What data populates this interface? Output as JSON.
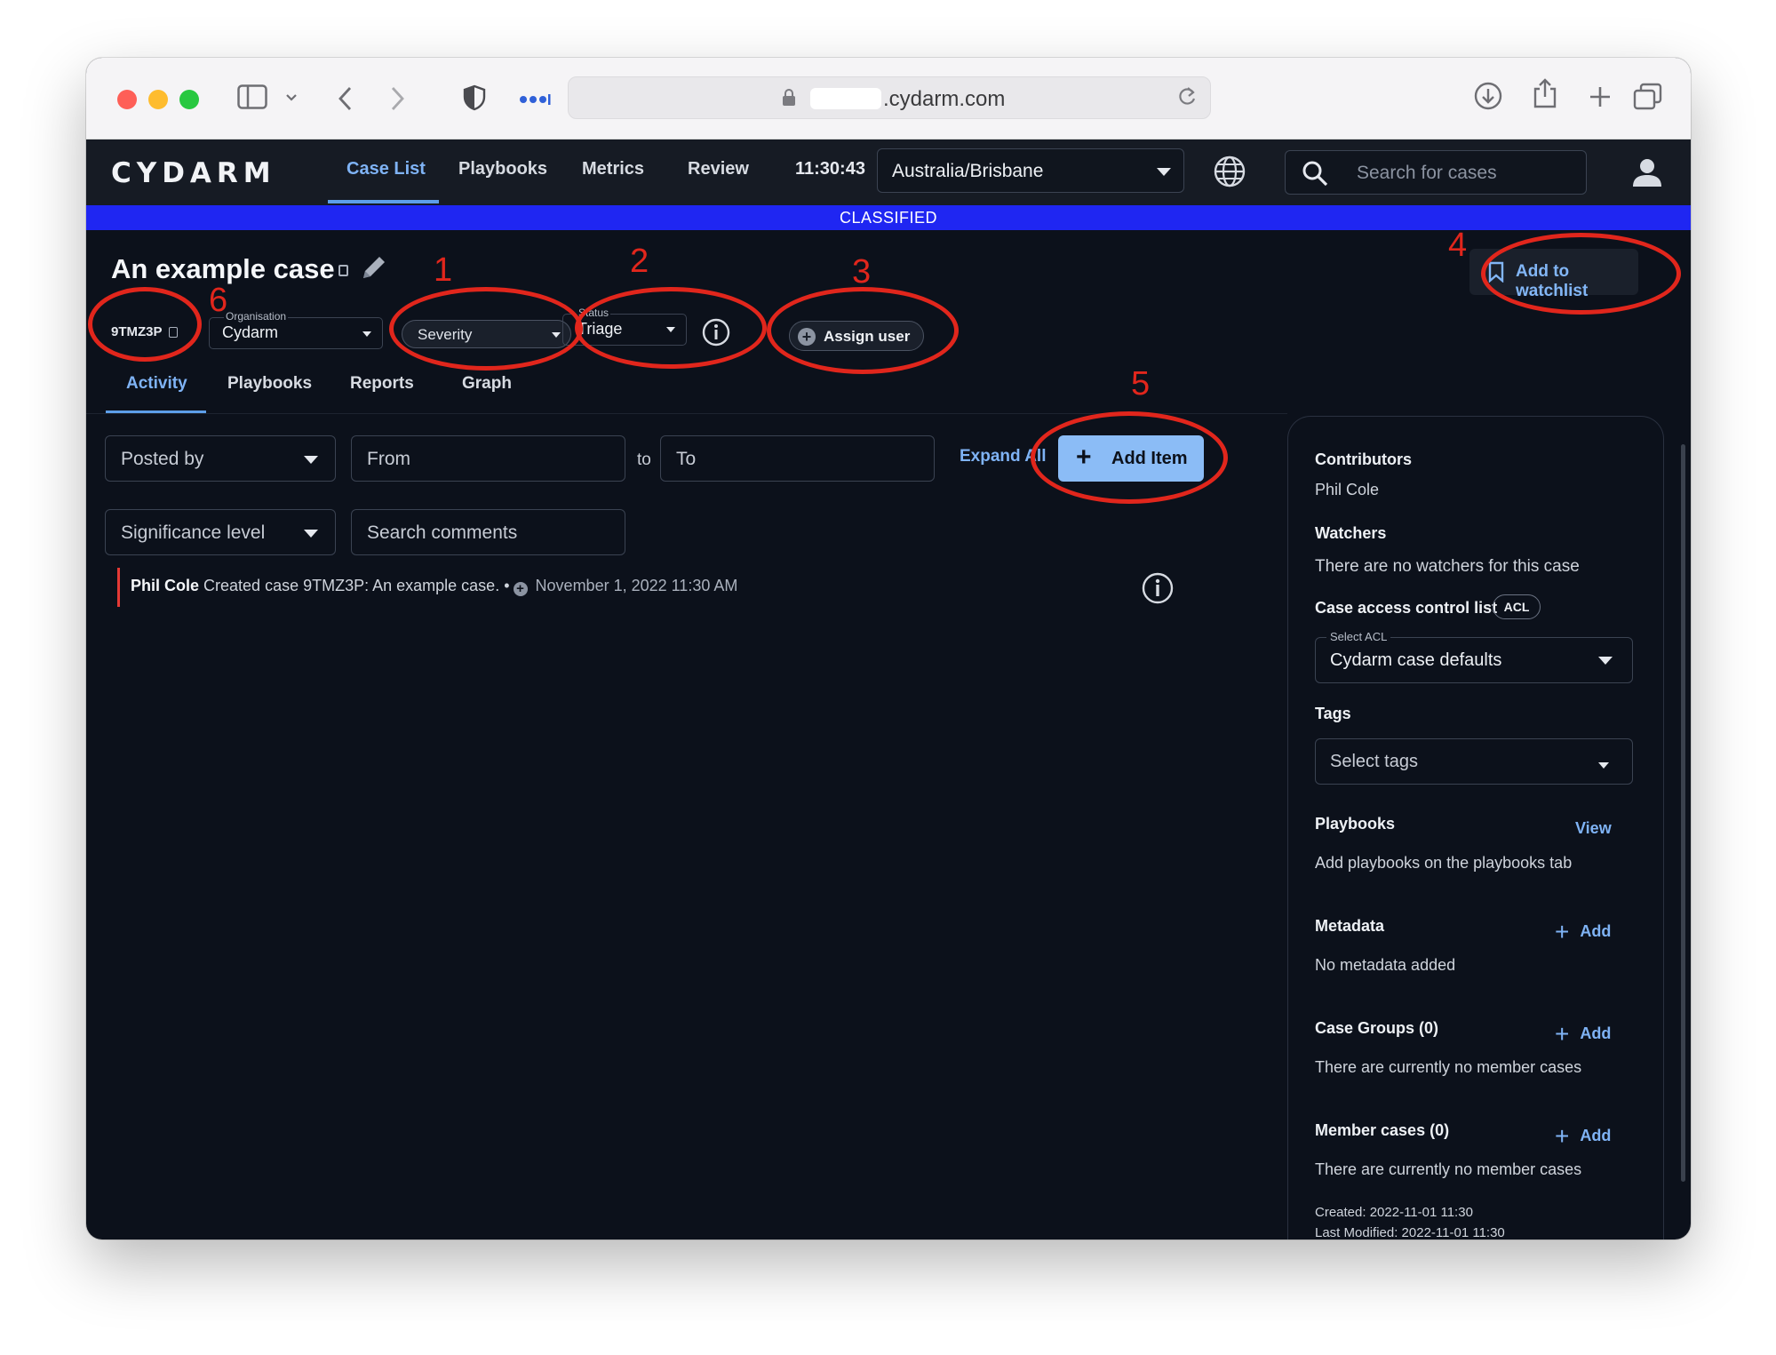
{
  "browser": {
    "url_domain": ".cydarm.com"
  },
  "app": {
    "logo": "CYDARM",
    "nav": [
      {
        "label": "Case List"
      },
      {
        "label": "Playbooks"
      },
      {
        "label": "Metrics"
      },
      {
        "label": "Review"
      }
    ],
    "clock": "11:30:43",
    "timezone": "Australia/Brisbane",
    "search_placeholder": "Search for cases",
    "classification": "CLASSIFIED"
  },
  "case": {
    "title": "An example case",
    "id": "9TMZ3P",
    "organisation_label": "Organisation",
    "organisation_value": "Cydarm",
    "severity_placeholder": "Severity",
    "status_label": "Status",
    "status_value": "Triage",
    "assign_label": "Assign user",
    "watchlist_label": "Add to watchlist"
  },
  "tabs": [
    {
      "label": "Activity"
    },
    {
      "label": "Playbooks"
    },
    {
      "label": "Reports"
    },
    {
      "label": "Graph"
    }
  ],
  "filters": {
    "posted_by": "Posted by",
    "from_placeholder": "From",
    "to_word": "to",
    "to_placeholder": "To",
    "significance": "Significance level",
    "search_comments_placeholder": "Search comments",
    "expand_all": "Expand All",
    "add_item": "Add Item"
  },
  "activity": [
    {
      "author": "Phil Cole",
      "text": "Created case 9TMZ3P: An example case.",
      "separator": "•",
      "date": "November 1, 2022 11:30 AM"
    }
  ],
  "sidebar": {
    "contributors_title": "Contributors",
    "contributors_value": "Phil Cole",
    "watchers_title": "Watchers",
    "watchers_value": "There are no watchers for this case",
    "acl_title": "Case access control list",
    "acl_badge": "ACL",
    "acl_select_label": "Select ACL",
    "acl_select_value": "Cydarm case defaults",
    "tags_title": "Tags",
    "tags_placeholder": "Select tags",
    "playbooks_title": "Playbooks",
    "playbooks_link": "View",
    "playbooks_value": "Add playbooks on the playbooks tab",
    "metadata_title": "Metadata",
    "metadata_add": "Add",
    "metadata_value": "No metadata added",
    "case_groups_title": "Case Groups (0)",
    "case_groups_add": "Add",
    "case_groups_value": "There are currently no member cases",
    "member_cases_title": "Member cases (0)",
    "member_cases_add": "Add",
    "member_cases_value": "There are currently no member cases",
    "created": "Created:  2022-11-01 11:30",
    "last_modified": "Last Modified:  2022-11-01 11:30"
  },
  "annotations": [
    "1",
    "2",
    "3",
    "4",
    "5",
    "6"
  ],
  "colors": {
    "background": "#0c111b",
    "accent": "#7fb3f5",
    "classified_banner": "#1f26f2",
    "annotation": "#e1261c",
    "add_item_button": "#8bbcf6"
  }
}
